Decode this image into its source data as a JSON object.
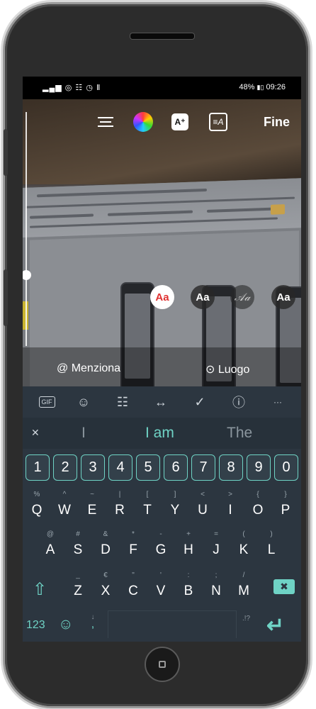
{
  "status_bar": {
    "left_icons": "▂▄▆ ◎ ☷ ◷ Ⅱ",
    "battery": "48%",
    "battery_icon": "▮▯",
    "time": "09:26"
  },
  "toolbar": {
    "icons": [
      "align-icon",
      "color-wheel-icon",
      "text-effect-icon",
      "animate-text-icon"
    ],
    "fx_label": "A⁺",
    "anim_label": "≡A",
    "done_label": "Fine"
  },
  "font_options": {
    "opt1": "Aa",
    "opt2": "Aa",
    "opt3": "𝒜𝒶",
    "opt4": "Aa"
  },
  "mention_bar": {
    "mention_icon": "@",
    "mention_label": "Menziona",
    "location_icon": "⊙",
    "location_label": "Luogo"
  },
  "keyboard": {
    "tools": {
      "gif": "GIF",
      "sticker": "☺",
      "clipboard": "☷",
      "translate": "↔",
      "check": "✓",
      "info": "ⓘ",
      "more": "···"
    },
    "suggestions": {
      "collapse": "✕",
      "s1": "I",
      "s2": "I am",
      "s3": "The"
    },
    "numbers": [
      "1",
      "2",
      "3",
      "4",
      "5",
      "6",
      "7",
      "8",
      "9",
      "0"
    ],
    "row1": [
      {
        "k": "Q",
        "a": "%"
      },
      {
        "k": "W",
        "a": "^"
      },
      {
        "k": "E",
        "a": "~"
      },
      {
        "k": "R",
        "a": "|"
      },
      {
        "k": "T",
        "a": "["
      },
      {
        "k": "Y",
        "a": "]"
      },
      {
        "k": "U",
        "a": "<"
      },
      {
        "k": "I",
        "a": ">"
      },
      {
        "k": "O",
        "a": "{"
      },
      {
        "k": "P",
        "a": "}"
      }
    ],
    "row2": [
      {
        "k": "A",
        "a": "@"
      },
      {
        "k": "S",
        "a": "#"
      },
      {
        "k": "D",
        "a": "&"
      },
      {
        "k": "F",
        "a": "*"
      },
      {
        "k": "G",
        "a": "-"
      },
      {
        "k": "H",
        "a": "+"
      },
      {
        "k": "J",
        "a": "="
      },
      {
        "k": "K",
        "a": "("
      },
      {
        "k": "L",
        "a": ")"
      }
    ],
    "row3": [
      {
        "k": "Z",
        "a": "_"
      },
      {
        "k": "X",
        "a": "€"
      },
      {
        "k": "C",
        "a": "\""
      },
      {
        "k": "V",
        "a": "'"
      },
      {
        "k": "B",
        "a": ":"
      },
      {
        "k": "N",
        "a": ";"
      },
      {
        "k": "M",
        "a": "/"
      }
    ],
    "shift": "⇧",
    "backspace": "✖",
    "bottom": {
      "numbers_label": "123",
      "emoji": "☺",
      "mic": "↓",
      "comma": ",",
      "punct": ".!?",
      "enter": "↵"
    }
  }
}
